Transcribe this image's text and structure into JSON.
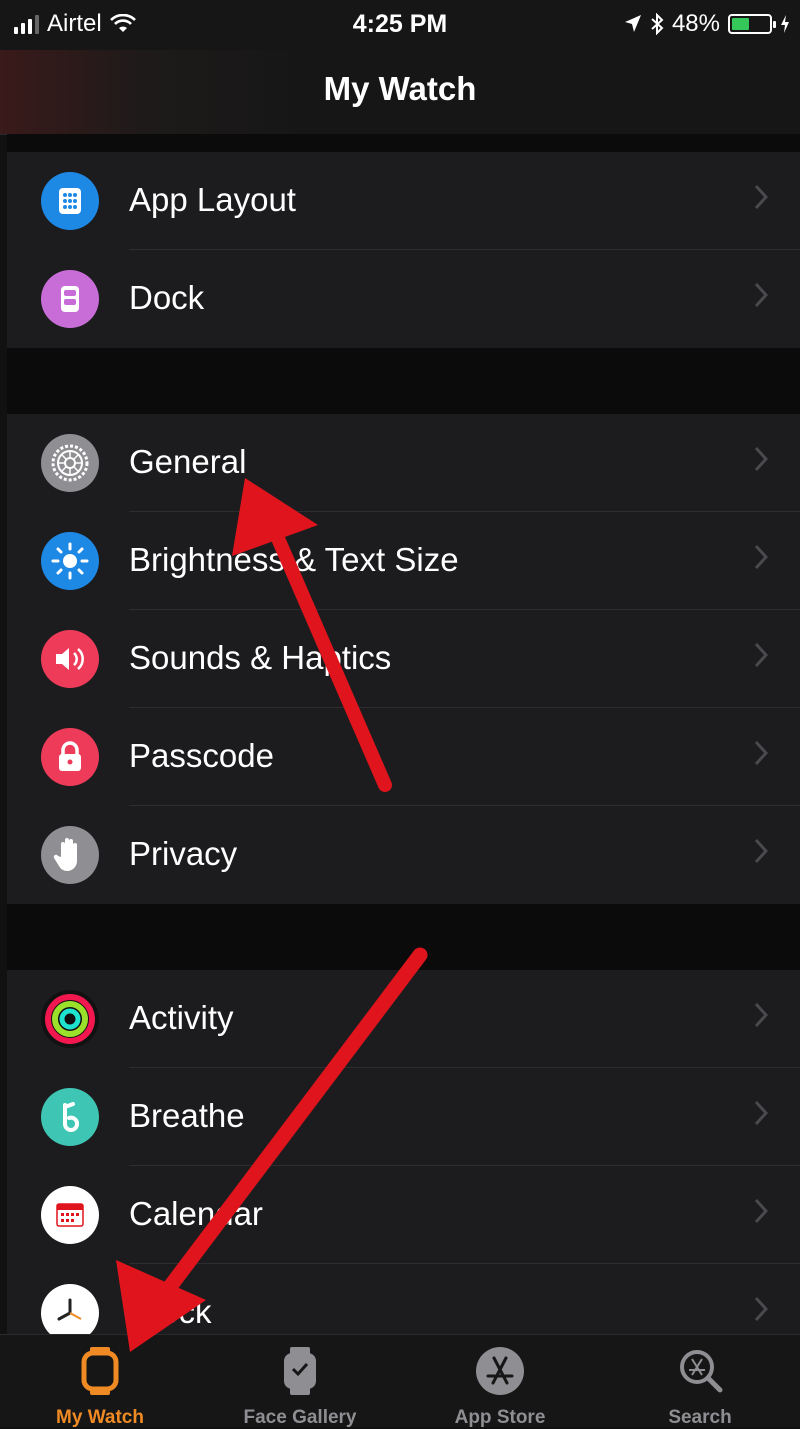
{
  "status_bar": {
    "carrier": "Airtel",
    "time": "4:25 PM",
    "battery_percent": "48%",
    "battery_level": 0.48
  },
  "nav": {
    "title": "My Watch"
  },
  "sections": [
    {
      "items": [
        {
          "label": "App Layout",
          "icon": "app-layout-icon",
          "color": "#1e88e5"
        },
        {
          "label": "Dock",
          "icon": "dock-icon",
          "color": "#c86dd7"
        }
      ]
    },
    {
      "items": [
        {
          "label": "General",
          "icon": "gear-icon",
          "color": "#8e8e93"
        },
        {
          "label": "Brightness & Text Size",
          "icon": "sun-icon",
          "color": "#1e88e5"
        },
        {
          "label": "Sounds & Haptics",
          "icon": "speaker-icon",
          "color": "#ef3b5a"
        },
        {
          "label": "Passcode",
          "icon": "lock-icon",
          "color": "#ef3b5a"
        },
        {
          "label": "Privacy",
          "icon": "hand-icon",
          "color": "#8e8e93"
        }
      ]
    },
    {
      "items": [
        {
          "label": "Activity",
          "icon": "activity-rings-icon",
          "color": "#111111"
        },
        {
          "label": "Breathe",
          "icon": "breathe-icon",
          "color": "#3fc5b3"
        },
        {
          "label": "Calendar",
          "icon": "calendar-icon",
          "color": "#ffffff"
        },
        {
          "label": "Clock",
          "icon": "clock-icon",
          "color": "#ffffff"
        }
      ]
    }
  ],
  "tabs": [
    {
      "label": "My Watch",
      "icon": "watch-icon",
      "active": true
    },
    {
      "label": "Face Gallery",
      "icon": "face-gallery-icon",
      "active": false
    },
    {
      "label": "App Store",
      "icon": "app-store-icon",
      "active": false
    },
    {
      "label": "Search",
      "icon": "search-icon",
      "active": false
    }
  ],
  "colors": {
    "accent": "#f08a24",
    "annotation_arrow": "#e0141c"
  }
}
